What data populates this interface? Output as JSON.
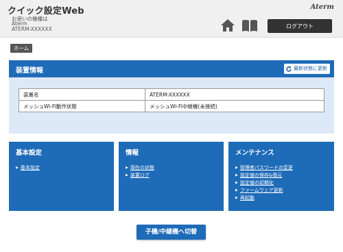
{
  "header": {
    "title": "クイック設定Web",
    "device_label": "お使いの機種は",
    "device_model": "Aterm",
    "device_id": "ATERM-XXXXXX",
    "brand": "Aterm",
    "logout_label": "ログアウト",
    "home_icon": "home-icon",
    "manual_icon": "book-icon"
  },
  "breadcrumb": {
    "home_label": "ホーム"
  },
  "device_info": {
    "title": "装置情報",
    "refresh_label": "最新状態に更新",
    "rows": [
      {
        "key": "装置名",
        "value": "ATERM-XXXXXX"
      },
      {
        "key": "メッシュWi-Fi動作状態",
        "value": "メッシュWi-Fi中継機(未接続)"
      }
    ]
  },
  "cards": {
    "basic": {
      "title": "基本設定",
      "items": [
        "基本設定"
      ]
    },
    "info": {
      "title": "情報",
      "items": [
        "現在の状態",
        "装置ログ"
      ]
    },
    "maintenance": {
      "title": "メンテナンス",
      "items": [
        "管理者パスワードの変更",
        "設定値の保存&復元",
        "設定値の初期化",
        "ファームウェア更新",
        "再起動"
      ]
    }
  },
  "switch_button_label": "子機/中継機へ切替",
  "colors": {
    "accent": "#1e6bb8",
    "panel": "#dde9f6",
    "header_bg": "#f0f0f0",
    "logout_bg": "#333333"
  }
}
